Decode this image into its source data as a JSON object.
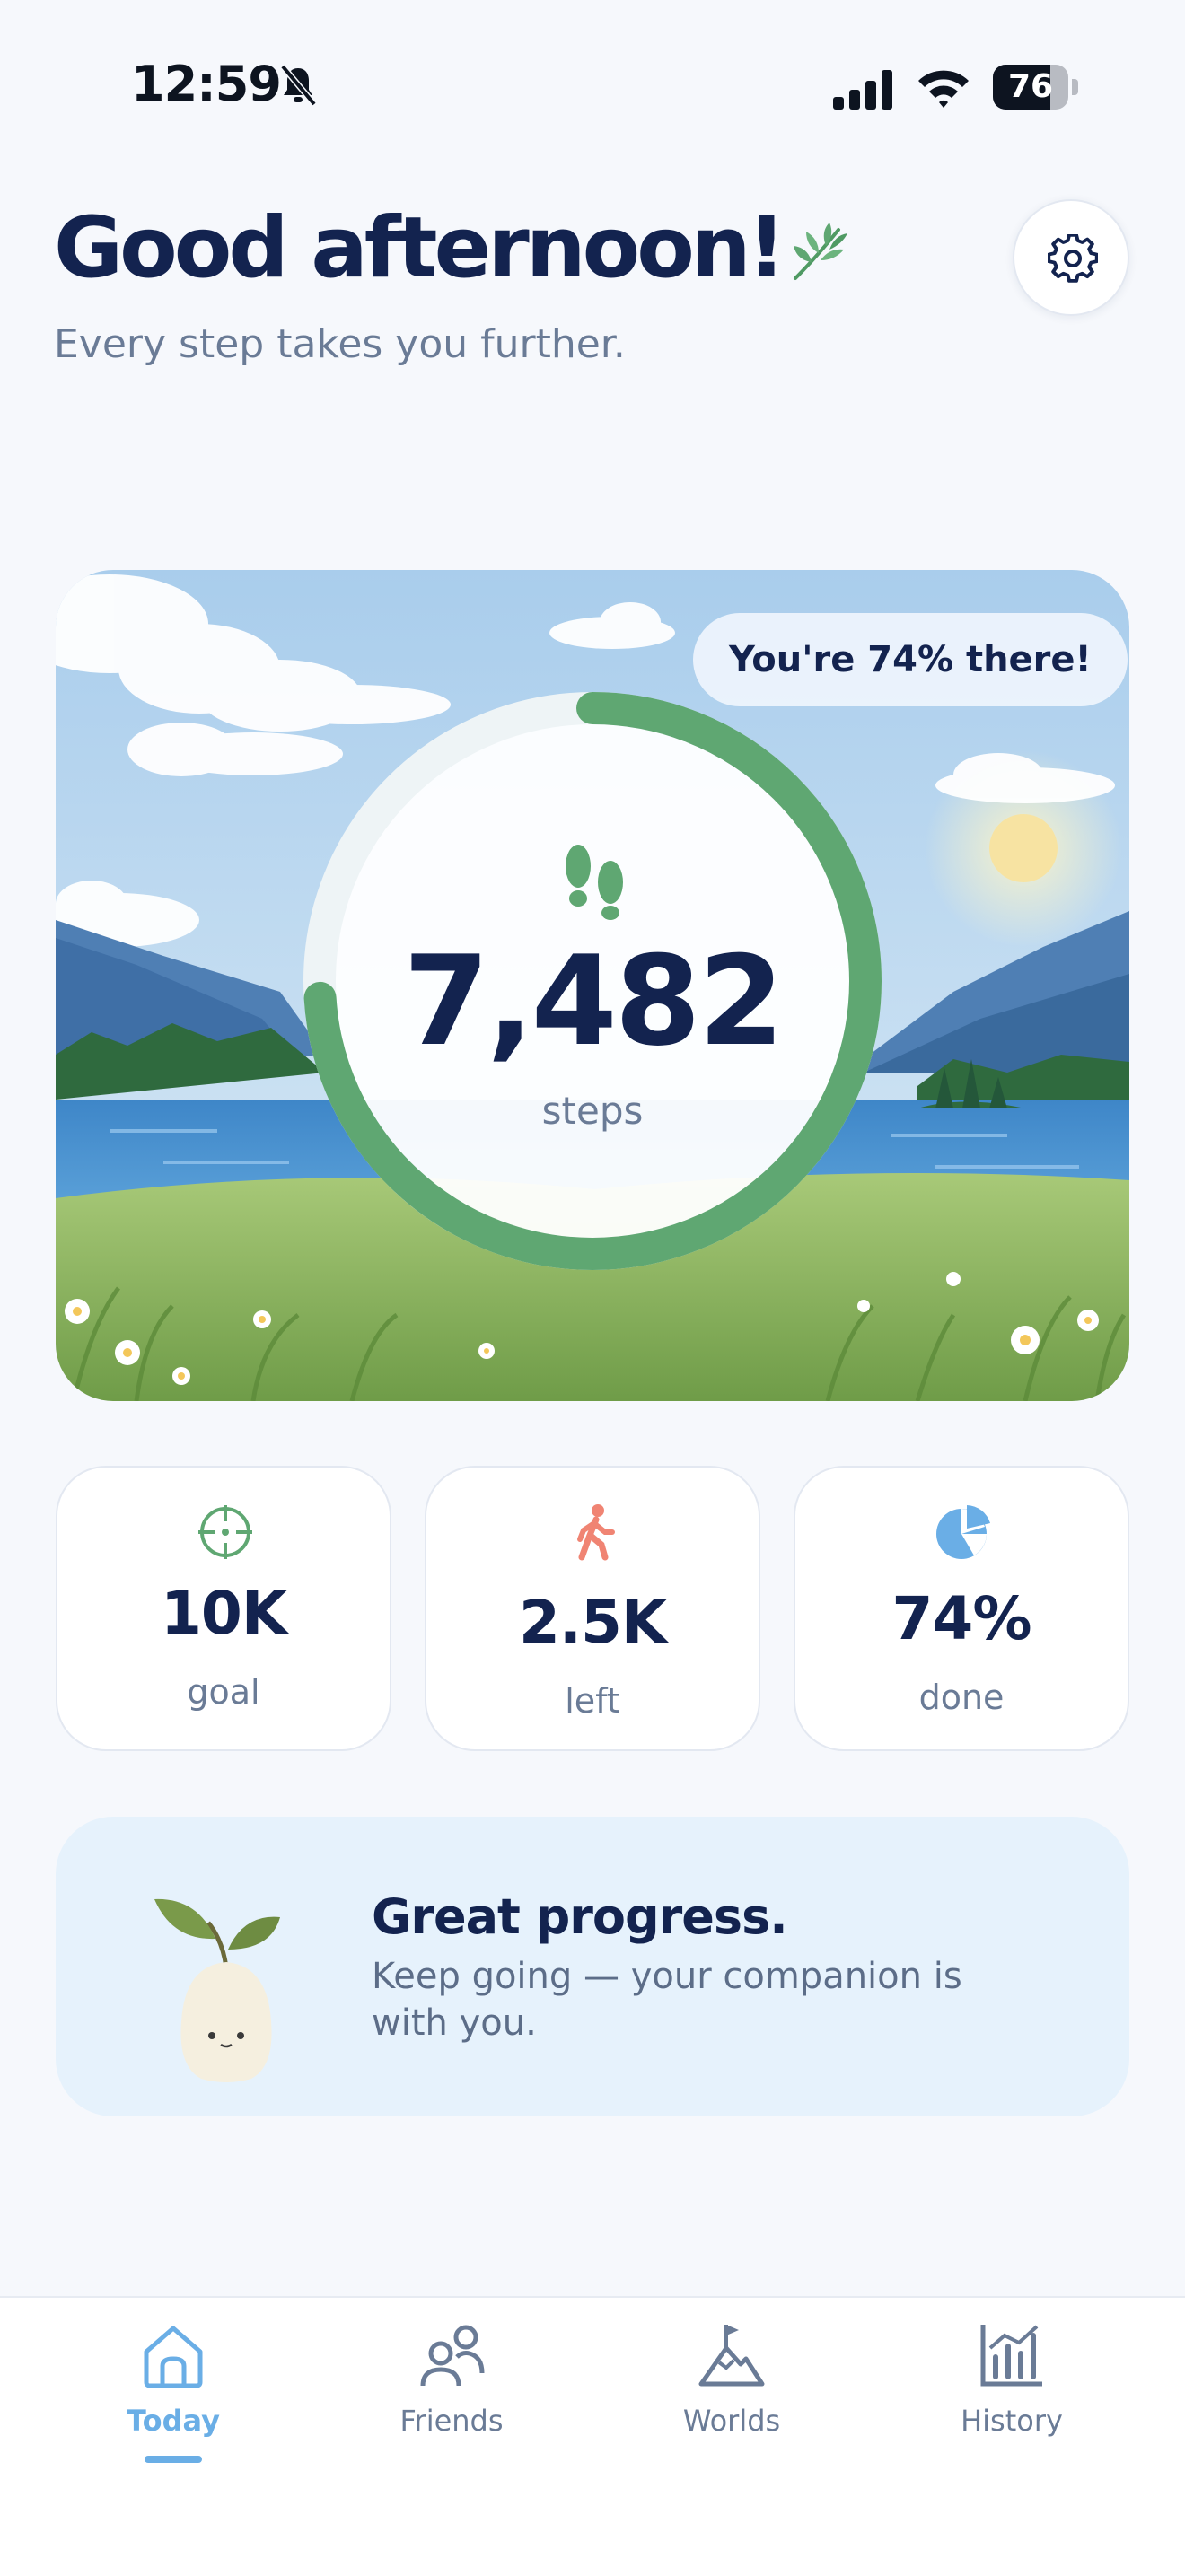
{
  "status_bar": {
    "time": "12:59",
    "battery": "76",
    "battery_level": 0.76,
    "icons": [
      "bell-slash-icon",
      "cellular-signal-icon",
      "wifi-icon",
      "battery-icon"
    ]
  },
  "header": {
    "greeting": "Good afternoon!",
    "greeting_icon": "leaf-icon",
    "subtitle": "Every step takes you further.",
    "settings_icon": "gear-icon"
  },
  "hero": {
    "badge": "You're 74% there!",
    "steps": "7,482",
    "steps_unit": "steps",
    "progress": 0.74,
    "icon": "footsteps-icon"
  },
  "stats": [
    {
      "value": "10K",
      "label": "goal",
      "icon": "target-icon"
    },
    {
      "value": "2.5K",
      "label": "left",
      "icon": "walking-person-icon"
    },
    {
      "value": "74%",
      "label": "done",
      "icon": "pie-chart-icon"
    }
  ],
  "progress_card": {
    "title": "Great progress.",
    "text": "Keep going — your companion is with you.",
    "icon": "sprout-companion-icon"
  },
  "tabs": [
    {
      "label": "Today",
      "icon": "home-icon",
      "active": true
    },
    {
      "label": "Friends",
      "icon": "people-icon",
      "active": false
    },
    {
      "label": "Worlds",
      "icon": "mountain-flag-icon",
      "active": false
    },
    {
      "label": "History",
      "icon": "bar-chart-icon",
      "active": false
    }
  ],
  "colors": {
    "accent_green": "#5fa772",
    "accent_blue": "#6aaee6",
    "text_primary": "#13234f",
    "text_secondary": "#6a7b96",
    "coral": "#f08473"
  }
}
